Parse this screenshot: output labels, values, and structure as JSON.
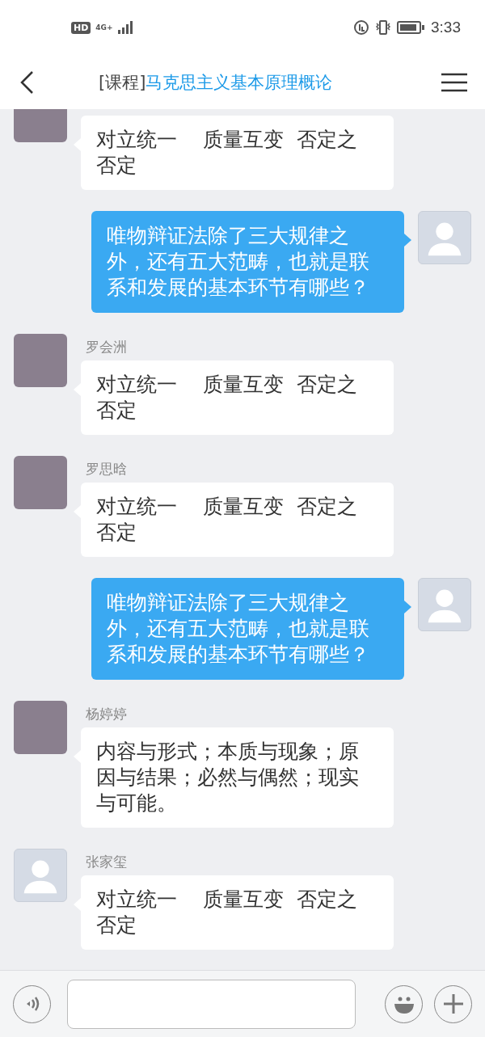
{
  "status_bar": {
    "hd": "HD",
    "network": "4G+",
    "time": "3:33"
  },
  "header": {
    "title_prefix": "[课程]",
    "title": "马克思主义基本原理概论"
  },
  "messages": [
    {
      "kind": "incoming",
      "avatar": {
        "kind": "photo"
      },
      "text": "对立统一    质量互变  否定之否定"
    },
    {
      "kind": "outgoing",
      "avatar": {
        "kind": "default"
      },
      "text": "唯物辩证法除了三大规律之外，还有五大范畴，也就是联系和发展的基本环节有哪些？"
    },
    {
      "kind": "incoming",
      "avatar": {
        "kind": "photo"
      },
      "name": "罗会洲",
      "text": "对立统一    质量互变  否定之否定"
    },
    {
      "kind": "incoming",
      "avatar": {
        "kind": "photo"
      },
      "name": "罗思晗",
      "text": "对立统一    质量互变  否定之否定"
    },
    {
      "kind": "outgoing",
      "avatar": {
        "kind": "default"
      },
      "text": "唯物辩证法除了三大规律之外，还有五大范畴，也就是联系和发展的基本环节有哪些？"
    },
    {
      "kind": "incoming",
      "avatar": {
        "kind": "photo"
      },
      "name": "杨婷婷",
      "text": "内容与形式；本质与现象；原因与结果；必然与偶然；现实与可能。"
    },
    {
      "kind": "incoming",
      "avatar": {
        "kind": "default"
      },
      "name": "张家玺",
      "text": "对立统一    质量互变  否定之否定"
    }
  ]
}
